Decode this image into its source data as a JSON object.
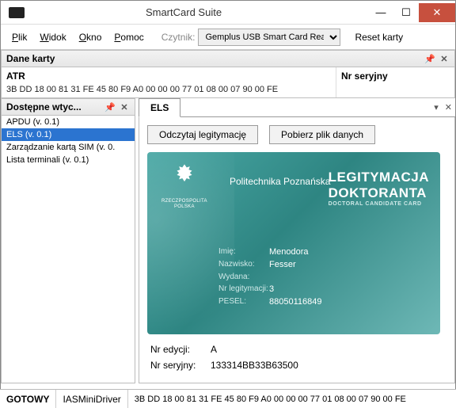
{
  "window": {
    "title": "SmartCard Suite"
  },
  "menu": {
    "plik": "Plik",
    "widok": "Widok",
    "okno": "Okno",
    "pomoc": "Pomoc",
    "reader_label": "Czytnik:",
    "reader_selected": "Gemplus USB Smart Card Reader (",
    "reset": "Reset karty"
  },
  "dane": {
    "title": "Dane karty",
    "atr_label": "ATR",
    "atr_value": "3B DD 18 00 81 31 FE 45 80 F9 A0 00 00 00 77 01 08 00 07 90 00 FE",
    "serial_label": "Nr seryjny"
  },
  "plugins": {
    "title": "Dostępne wtyc...",
    "items": [
      "APDU (v. 0.1)",
      "ELS (v. 0.1)",
      "Zarządzanie kartą SIM (v. 0.",
      "Lista terminali (v. 0.1)"
    ]
  },
  "els": {
    "tab": "ELS",
    "btn_read": "Odczytaj legitymację",
    "btn_download": "Pobierz plik danych",
    "university": "Politechnika Poznańska",
    "emblem_line1": "RZECZPOSPOLITA",
    "emblem_line2": "POLSKA",
    "legit_line1": "LEGITYMACJA",
    "legit_line2": "DOKTORANTA",
    "legit_line3": "DOCTORAL CANDIDATE CARD",
    "fields": {
      "imie_lbl": "Imię:",
      "imie": "Menodora",
      "nazwisko_lbl": "Nazwisko:",
      "nazwisko": "Fesser",
      "wydana_lbl": "Wydana:",
      "wydana": "",
      "nrleg_lbl": "Nr legitymacji:",
      "nrleg": "3",
      "pesel_lbl": "PESEL:",
      "pesel": "88050116849"
    },
    "edition_lbl": "Nr edycji:",
    "edition": "A",
    "serial_lbl": "Nr seryjny:",
    "serial": "133314BB33B63500"
  },
  "status": {
    "ready": "GOTOWY",
    "driver": "IASMiniDriver",
    "atr": "3B DD 18 00 81 31 FE 45 80 F9 A0 00 00 00 77 01 08 00 07 90 00 FE"
  }
}
